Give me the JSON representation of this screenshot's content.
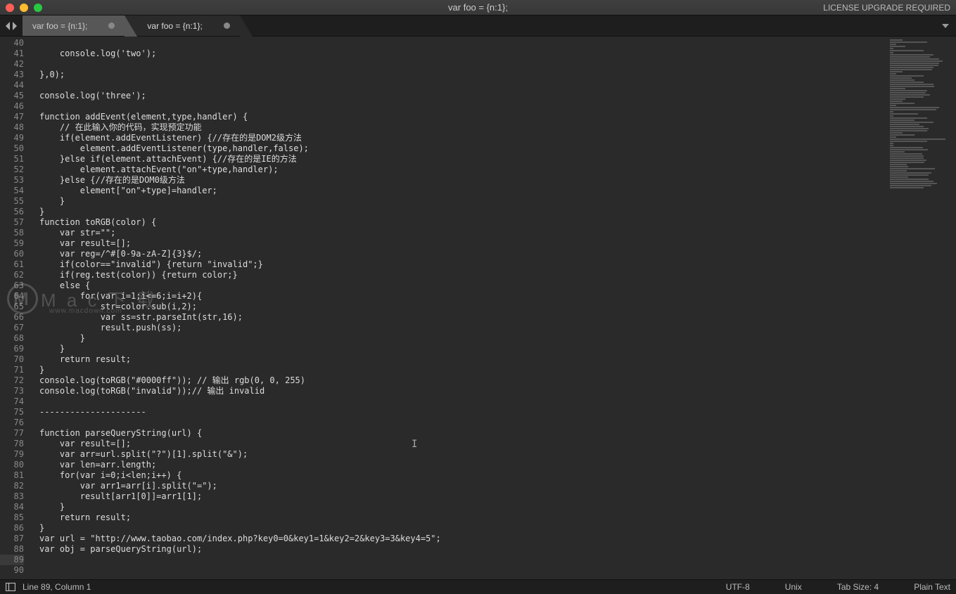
{
  "titlebar": {
    "title": "var foo = {n:1};",
    "license": "LICENSE UPGRADE REQUIRED"
  },
  "tabs": {
    "items": [
      {
        "label": "var foo = {n:1};",
        "active": false,
        "modified": true
      },
      {
        "label": "var foo = {n:1};",
        "active": true,
        "modified": true
      }
    ]
  },
  "editor": {
    "first_line_number": 40,
    "current_line_number": 89,
    "lines": [
      "",
      "    console.log('two');",
      "",
      "},0);",
      "",
      "console.log('three');",
      "",
      "function addEvent(element,type,handler) {",
      "    // 在此输入你的代码，实现预定功能",
      "    if(element.addEventListener) {//存在的是DOM2级方法",
      "        element.addEventListener(type,handler,false);",
      "    }else if(element.attachEvent) {//存在的是IE的方法",
      "        element.attachEvent(\"on\"+type,handler);",
      "    }else {//存在的是DOM0级方法",
      "        element[\"on\"+type]=handler;",
      "    }",
      "}",
      "function toRGB(color) {",
      "    var str=\"\";",
      "    var result=[];",
      "    var reg=/^#[0-9a-zA-Z]{3}$/;",
      "    if(color==\"invalid\") {return \"invalid\";}",
      "    if(reg.test(color)) {return color;}",
      "    else {",
      "        for(var i=1;i<=6;i=i+2){",
      "            str=color.sub(i,2);",
      "            var ss=str.parseInt(str,16);",
      "            result.push(ss);",
      "        }",
      "    }",
      "    return result;",
      "}",
      "console.log(toRGB(\"#0000ff\")); // 输出 rgb(0, 0, 255)",
      "console.log(toRGB(\"invalid\"));// 输出 invalid",
      "",
      "---------------------",
      "",
      "function parseQueryString(url) {",
      "    var result=[];",
      "    var arr=url.split(\"?\")[1].split(\"&\");",
      "    var len=arr.length;",
      "    for(var i=0;i<len;i++) {",
      "        var arr1=arr[i].split(\"=\");",
      "        result[arr1[0]]=arr1[1];",
      "    }",
      "    return result;",
      "}",
      "var url = \"http://www.taobao.com/index.php?key0=0&key1=1&key2=2&key3=3&key4=5\";",
      "var obj = parseQueryString(url);",
      "",
      ""
    ]
  },
  "statusbar": {
    "position": "Line 89, Column 1",
    "encoding": "UTF-8",
    "line_ending": "Unix",
    "tab_size": "Tab Size: 4",
    "syntax": "Plain Text"
  },
  "watermark": {
    "logo_letter": "M",
    "text": "M a c 下 载",
    "sub": "www.macdown.com"
  }
}
